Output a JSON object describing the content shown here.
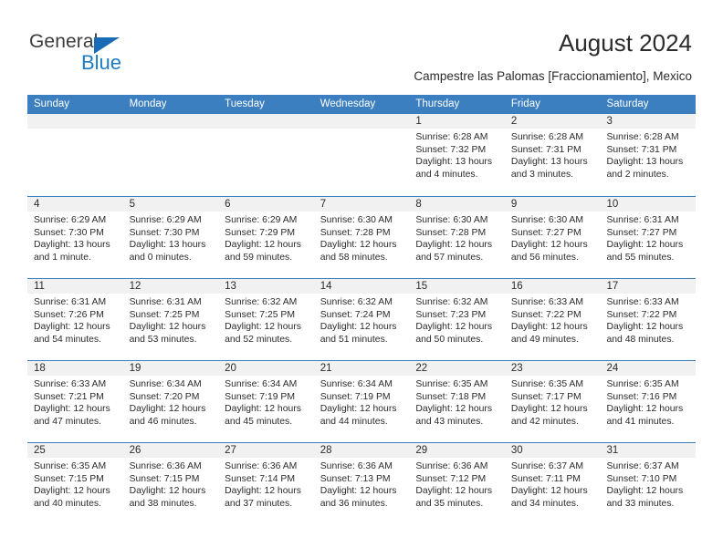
{
  "logo": {
    "word_general": "General",
    "word_blue": "Blue",
    "triangle_color": "#1a6bb5",
    "blue_color": "#1f7ac4"
  },
  "header": {
    "title": "August 2024",
    "subtitle": "Campestre las Palomas [Fraccionamiento], Mexico"
  },
  "theme": {
    "header_band": "#3c7fc0",
    "date_band": "#f1f1f1",
    "text": "#2b2b2b"
  },
  "calendar": {
    "weekdays": [
      "Sunday",
      "Monday",
      "Tuesday",
      "Wednesday",
      "Thursday",
      "Friday",
      "Saturday"
    ],
    "weeks": [
      [
        {
          "day": "",
          "sunrise": "",
          "sunset": "",
          "daylight_line1": "",
          "daylight_line2": ""
        },
        {
          "day": "",
          "sunrise": "",
          "sunset": "",
          "daylight_line1": "",
          "daylight_line2": ""
        },
        {
          "day": "",
          "sunrise": "",
          "sunset": "",
          "daylight_line1": "",
          "daylight_line2": ""
        },
        {
          "day": "",
          "sunrise": "",
          "sunset": "",
          "daylight_line1": "",
          "daylight_line2": ""
        },
        {
          "day": "1",
          "sunrise": "Sunrise: 6:28 AM",
          "sunset": "Sunset: 7:32 PM",
          "daylight_line1": "Daylight: 13 hours",
          "daylight_line2": "and 4 minutes."
        },
        {
          "day": "2",
          "sunrise": "Sunrise: 6:28 AM",
          "sunset": "Sunset: 7:31 PM",
          "daylight_line1": "Daylight: 13 hours",
          "daylight_line2": "and 3 minutes."
        },
        {
          "day": "3",
          "sunrise": "Sunrise: 6:28 AM",
          "sunset": "Sunset: 7:31 PM",
          "daylight_line1": "Daylight: 13 hours",
          "daylight_line2": "and 2 minutes."
        }
      ],
      [
        {
          "day": "4",
          "sunrise": "Sunrise: 6:29 AM",
          "sunset": "Sunset: 7:30 PM",
          "daylight_line1": "Daylight: 13 hours",
          "daylight_line2": "and 1 minute."
        },
        {
          "day": "5",
          "sunrise": "Sunrise: 6:29 AM",
          "sunset": "Sunset: 7:30 PM",
          "daylight_line1": "Daylight: 13 hours",
          "daylight_line2": "and 0 minutes."
        },
        {
          "day": "6",
          "sunrise": "Sunrise: 6:29 AM",
          "sunset": "Sunset: 7:29 PM",
          "daylight_line1": "Daylight: 12 hours",
          "daylight_line2": "and 59 minutes."
        },
        {
          "day": "7",
          "sunrise": "Sunrise: 6:30 AM",
          "sunset": "Sunset: 7:28 PM",
          "daylight_line1": "Daylight: 12 hours",
          "daylight_line2": "and 58 minutes."
        },
        {
          "day": "8",
          "sunrise": "Sunrise: 6:30 AM",
          "sunset": "Sunset: 7:28 PM",
          "daylight_line1": "Daylight: 12 hours",
          "daylight_line2": "and 57 minutes."
        },
        {
          "day": "9",
          "sunrise": "Sunrise: 6:30 AM",
          "sunset": "Sunset: 7:27 PM",
          "daylight_line1": "Daylight: 12 hours",
          "daylight_line2": "and 56 minutes."
        },
        {
          "day": "10",
          "sunrise": "Sunrise: 6:31 AM",
          "sunset": "Sunset: 7:27 PM",
          "daylight_line1": "Daylight: 12 hours",
          "daylight_line2": "and 55 minutes."
        }
      ],
      [
        {
          "day": "11",
          "sunrise": "Sunrise: 6:31 AM",
          "sunset": "Sunset: 7:26 PM",
          "daylight_line1": "Daylight: 12 hours",
          "daylight_line2": "and 54 minutes."
        },
        {
          "day": "12",
          "sunrise": "Sunrise: 6:31 AM",
          "sunset": "Sunset: 7:25 PM",
          "daylight_line1": "Daylight: 12 hours",
          "daylight_line2": "and 53 minutes."
        },
        {
          "day": "13",
          "sunrise": "Sunrise: 6:32 AM",
          "sunset": "Sunset: 7:25 PM",
          "daylight_line1": "Daylight: 12 hours",
          "daylight_line2": "and 52 minutes."
        },
        {
          "day": "14",
          "sunrise": "Sunrise: 6:32 AM",
          "sunset": "Sunset: 7:24 PM",
          "daylight_line1": "Daylight: 12 hours",
          "daylight_line2": "and 51 minutes."
        },
        {
          "day": "15",
          "sunrise": "Sunrise: 6:32 AM",
          "sunset": "Sunset: 7:23 PM",
          "daylight_line1": "Daylight: 12 hours",
          "daylight_line2": "and 50 minutes."
        },
        {
          "day": "16",
          "sunrise": "Sunrise: 6:33 AM",
          "sunset": "Sunset: 7:22 PM",
          "daylight_line1": "Daylight: 12 hours",
          "daylight_line2": "and 49 minutes."
        },
        {
          "day": "17",
          "sunrise": "Sunrise: 6:33 AM",
          "sunset": "Sunset: 7:22 PM",
          "daylight_line1": "Daylight: 12 hours",
          "daylight_line2": "and 48 minutes."
        }
      ],
      [
        {
          "day": "18",
          "sunrise": "Sunrise: 6:33 AM",
          "sunset": "Sunset: 7:21 PM",
          "daylight_line1": "Daylight: 12 hours",
          "daylight_line2": "and 47 minutes."
        },
        {
          "day": "19",
          "sunrise": "Sunrise: 6:34 AM",
          "sunset": "Sunset: 7:20 PM",
          "daylight_line1": "Daylight: 12 hours",
          "daylight_line2": "and 46 minutes."
        },
        {
          "day": "20",
          "sunrise": "Sunrise: 6:34 AM",
          "sunset": "Sunset: 7:19 PM",
          "daylight_line1": "Daylight: 12 hours",
          "daylight_line2": "and 45 minutes."
        },
        {
          "day": "21",
          "sunrise": "Sunrise: 6:34 AM",
          "sunset": "Sunset: 7:19 PM",
          "daylight_line1": "Daylight: 12 hours",
          "daylight_line2": "and 44 minutes."
        },
        {
          "day": "22",
          "sunrise": "Sunrise: 6:35 AM",
          "sunset": "Sunset: 7:18 PM",
          "daylight_line1": "Daylight: 12 hours",
          "daylight_line2": "and 43 minutes."
        },
        {
          "day": "23",
          "sunrise": "Sunrise: 6:35 AM",
          "sunset": "Sunset: 7:17 PM",
          "daylight_line1": "Daylight: 12 hours",
          "daylight_line2": "and 42 minutes."
        },
        {
          "day": "24",
          "sunrise": "Sunrise: 6:35 AM",
          "sunset": "Sunset: 7:16 PM",
          "daylight_line1": "Daylight: 12 hours",
          "daylight_line2": "and 41 minutes."
        }
      ],
      [
        {
          "day": "25",
          "sunrise": "Sunrise: 6:35 AM",
          "sunset": "Sunset: 7:15 PM",
          "daylight_line1": "Daylight: 12 hours",
          "daylight_line2": "and 40 minutes."
        },
        {
          "day": "26",
          "sunrise": "Sunrise: 6:36 AM",
          "sunset": "Sunset: 7:15 PM",
          "daylight_line1": "Daylight: 12 hours",
          "daylight_line2": "and 38 minutes."
        },
        {
          "day": "27",
          "sunrise": "Sunrise: 6:36 AM",
          "sunset": "Sunset: 7:14 PM",
          "daylight_line1": "Daylight: 12 hours",
          "daylight_line2": "and 37 minutes."
        },
        {
          "day": "28",
          "sunrise": "Sunrise: 6:36 AM",
          "sunset": "Sunset: 7:13 PM",
          "daylight_line1": "Daylight: 12 hours",
          "daylight_line2": "and 36 minutes."
        },
        {
          "day": "29",
          "sunrise": "Sunrise: 6:36 AM",
          "sunset": "Sunset: 7:12 PM",
          "daylight_line1": "Daylight: 12 hours",
          "daylight_line2": "and 35 minutes."
        },
        {
          "day": "30",
          "sunrise": "Sunrise: 6:37 AM",
          "sunset": "Sunset: 7:11 PM",
          "daylight_line1": "Daylight: 12 hours",
          "daylight_line2": "and 34 minutes."
        },
        {
          "day": "31",
          "sunrise": "Sunrise: 6:37 AM",
          "sunset": "Sunset: 7:10 PM",
          "daylight_line1": "Daylight: 12 hours",
          "daylight_line2": "and 33 minutes."
        }
      ]
    ]
  }
}
